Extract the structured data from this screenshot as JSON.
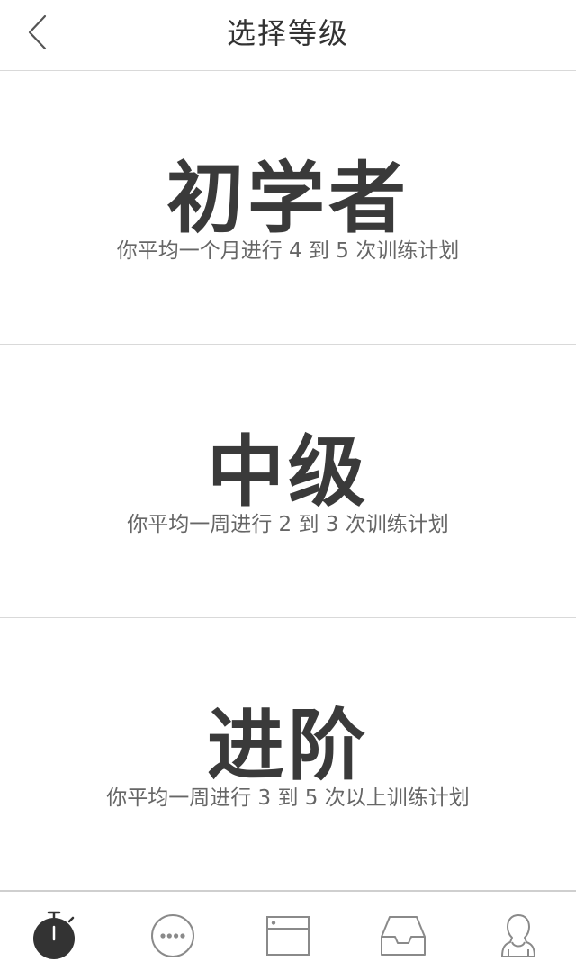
{
  "header": {
    "title": "选择等级"
  },
  "levels": [
    {
      "name": "初学者",
      "desc": "你平均一个月进行 4 到 5 次训练计划"
    },
    {
      "name": "中级",
      "desc": "你平均一周进行 2 到 3 次训练计划"
    },
    {
      "name": "进阶",
      "desc": "你平均一周进行 3 到 5 次以上训练计划"
    }
  ],
  "tabbar": {
    "tabs": [
      {
        "icon": "stopwatch-icon",
        "active": true
      },
      {
        "icon": "chat-bubble-icon",
        "active": false
      },
      {
        "icon": "browser-window-icon",
        "active": false
      },
      {
        "icon": "inbox-tray-icon",
        "active": false
      },
      {
        "icon": "profile-person-icon",
        "active": false
      }
    ]
  },
  "colors": {
    "text_primary": "#333333",
    "text_secondary": "#666666",
    "divider": "#d9d9d9",
    "icon_gray": "#8a8a8a",
    "icon_active": "#333333"
  }
}
